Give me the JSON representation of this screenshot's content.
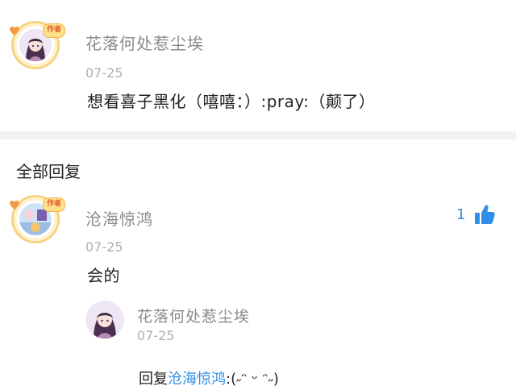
{
  "post": {
    "author": "花落何处惹尘埃",
    "badge": "作者",
    "date": "07-25",
    "content": "想看喜子黑化（嘻嘻：）:pray:（颠了）"
  },
  "replies_header": "全部回复",
  "reply": {
    "author": "沧海惊鸿",
    "badge": "作者",
    "date": "07-25",
    "content": "会的",
    "likes": "1",
    "sub_reply": {
      "author": "花落何处惹尘埃",
      "date": "07-25",
      "prefix": "回复",
      "target": "沧海惊鸿",
      "text": ":(˶ᵔ ᵕ ᵔ˶)"
    }
  },
  "colors": {
    "accent": "#2f8fe8",
    "name_gray": "#8a8a8a",
    "date_gray": "#b0b0b0"
  },
  "icons": [
    "heart-icon",
    "thumbs-up-icon"
  ]
}
